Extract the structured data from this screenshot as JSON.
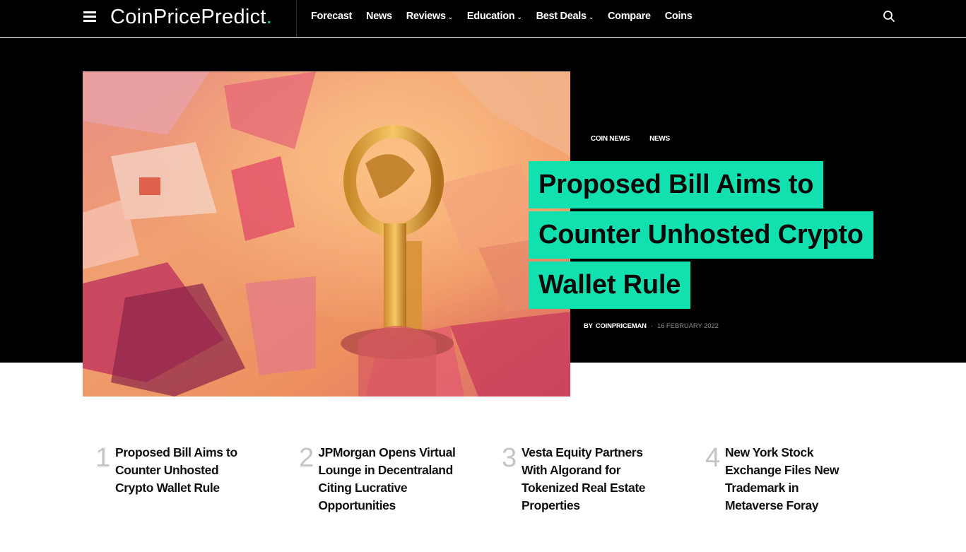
{
  "header": {
    "logo_text": "CoinPricePredict",
    "logo_dot": ".",
    "nav": [
      {
        "label": "Forecast",
        "has_dropdown": false
      },
      {
        "label": "News",
        "has_dropdown": false
      },
      {
        "label": "Reviews",
        "has_dropdown": true
      },
      {
        "label": "Education",
        "has_dropdown": true
      },
      {
        "label": "Best Deals",
        "has_dropdown": true
      },
      {
        "label": "Compare",
        "has_dropdown": false
      },
      {
        "label": "Coins",
        "has_dropdown": false
      }
    ],
    "caret": "⌄",
    "icons": {
      "menu": "hamburger-menu-icon",
      "search": "search-icon"
    }
  },
  "hero": {
    "categories": [
      "COIN NEWS",
      "NEWS"
    ],
    "headline_lines": [
      "Proposed Bill Aims to",
      "Counter Unhosted Crypto",
      "Wallet Rule"
    ],
    "by_label": "BY",
    "author": "COINPRICEMAN",
    "separator": "·",
    "date": "16 FEBRUARY 2022",
    "image": "abstract-golden-key-artwork"
  },
  "trending": [
    {
      "number": "1",
      "title": "Proposed Bill Aims to Counter Unhosted Crypto Wallet Rule"
    },
    {
      "number": "2",
      "title": "JPMorgan Opens Virtual Lounge in Decentraland Citing Lucrative Opportunities"
    },
    {
      "number": "3",
      "title": "Vesta Equity Partners With Algorand for Tokenized Real Estate Properties"
    },
    {
      "number": "4",
      "title": "New York Stock Exchange Files New Trademark in Metaverse Foray"
    }
  ],
  "colors": {
    "accent": "#12e0ae",
    "background_dark": "#000000",
    "text_dark": "#111111"
  }
}
